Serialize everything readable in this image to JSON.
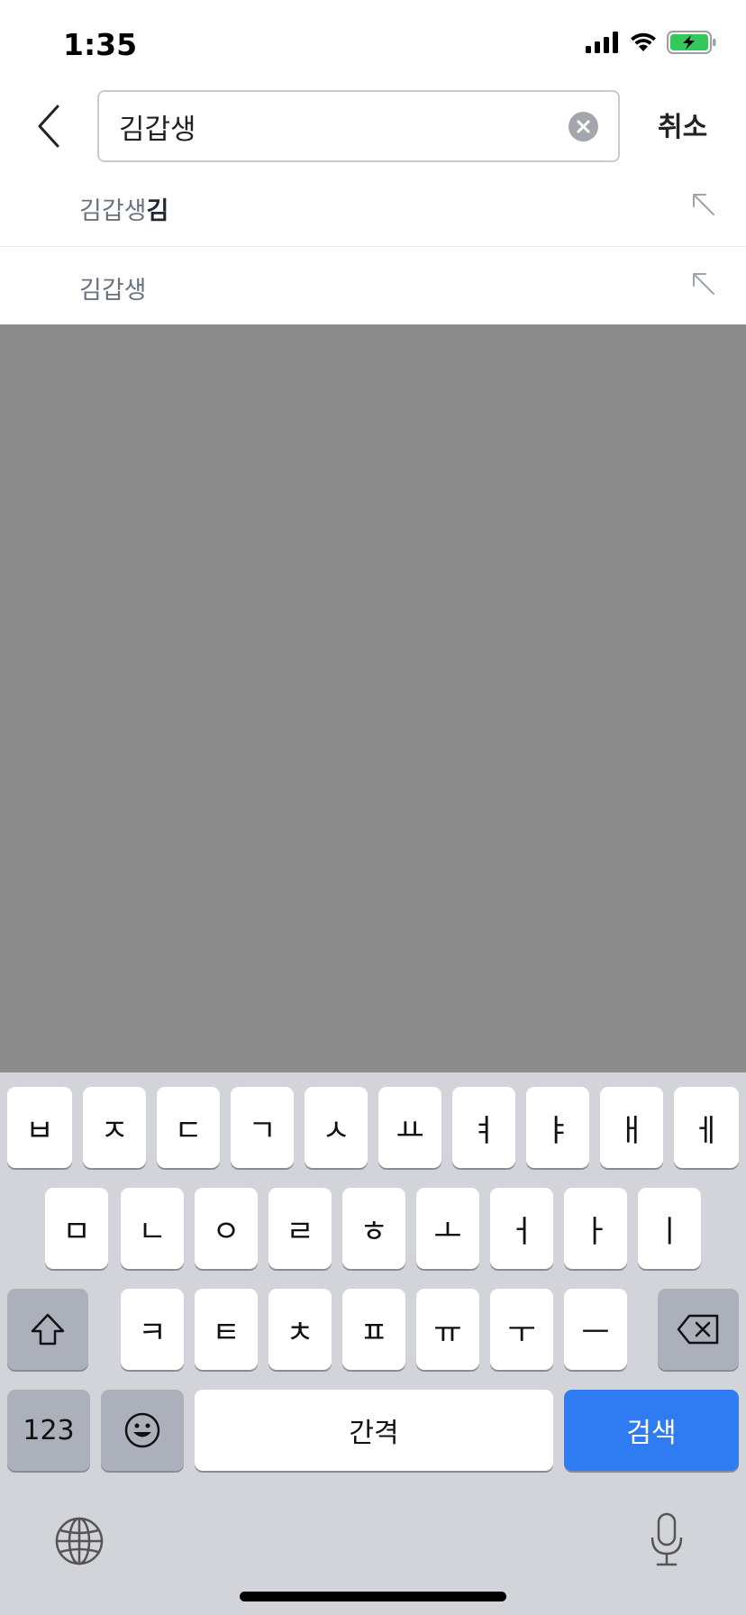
{
  "status_bar": {
    "time": "1:35",
    "icons": [
      "cellular-signal-icon",
      "wifi-icon",
      "battery-charging-icon"
    ]
  },
  "header": {
    "back_icon": "chevron-left-icon",
    "search": {
      "value": "김갑생",
      "clear_icon": "clear-circle-icon"
    },
    "cancel_label": "취소"
  },
  "suggestions": [
    {
      "prefix": "김갑생",
      "highlight": "김",
      "icon": "arrow-up-left-icon"
    },
    {
      "prefix": "김갑생",
      "highlight": "",
      "icon": "arrow-up-left-icon"
    }
  ],
  "keyboard": {
    "row1": [
      "ㅂ",
      "ㅈ",
      "ㄷ",
      "ㄱ",
      "ㅅ",
      "ㅛ",
      "ㅕ",
      "ㅑ",
      "ㅐ",
      "ㅔ"
    ],
    "row2": [
      "ㅁ",
      "ㄴ",
      "ㅇ",
      "ㄹ",
      "ㅎ",
      "ㅗ",
      "ㅓ",
      "ㅏ",
      "ㅣ"
    ],
    "row3": [
      "ㅋ",
      "ㅌ",
      "ㅊ",
      "ㅍ",
      "ㅠ",
      "ㅜ",
      "ㅡ"
    ],
    "shift_icon": "shift-icon",
    "backspace_icon": "backspace-icon",
    "numbers_label": "123",
    "emoji_icon": "emoji-icon",
    "space_label": "간격",
    "search_label": "검색",
    "globe_icon": "globe-icon",
    "mic_icon": "microphone-icon"
  },
  "colors": {
    "dim_overlay": "#8c8c8c",
    "keyboard_bg": "#d2d4da",
    "search_key": "#2f7bf2",
    "battery_green": "#34c759"
  }
}
